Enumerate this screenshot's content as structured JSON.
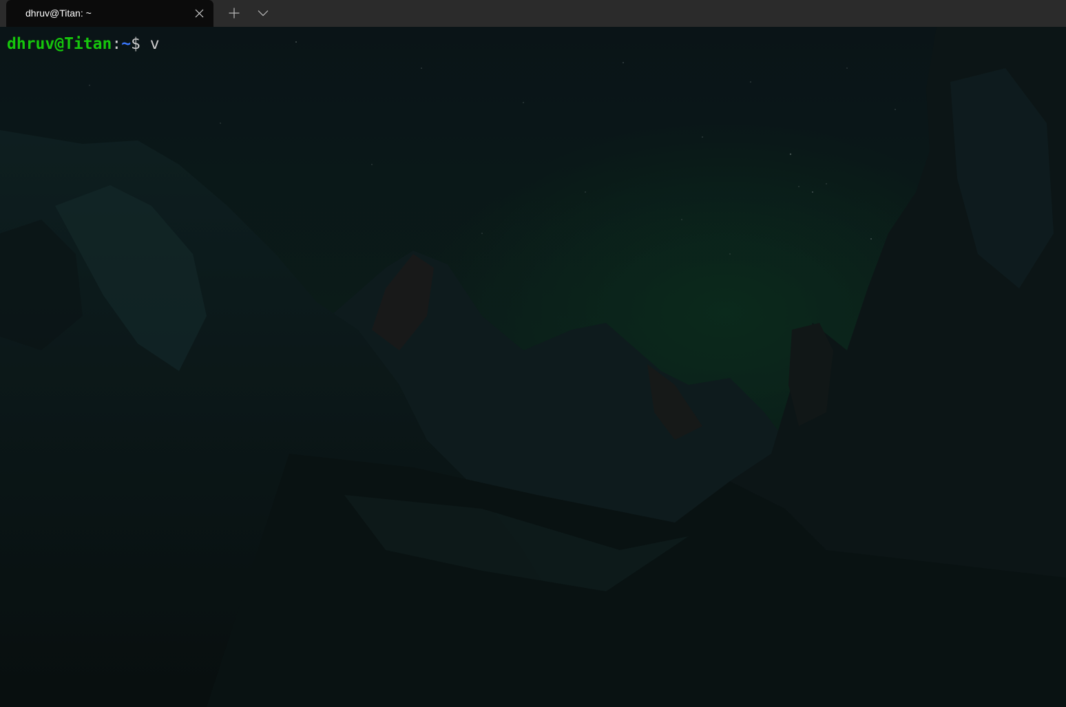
{
  "tab": {
    "title": "dhruv@Titan: ~",
    "close_icon": "close-icon",
    "new_tab_icon": "plus-icon",
    "dropdown_icon": "chevron-down-icon"
  },
  "terminal": {
    "prompt": {
      "user_host": "dhruv@Titan",
      "separator": ":",
      "path": "~",
      "symbol": "$",
      "command": " v"
    },
    "background": "mountain-night-wallpaper"
  },
  "colors": {
    "prompt_user": "#16c60c",
    "prompt_path": "#3b78ff",
    "text": "#cccccc",
    "titlebar": "#2b2b2b",
    "active_tab": "#0b0b0b"
  }
}
